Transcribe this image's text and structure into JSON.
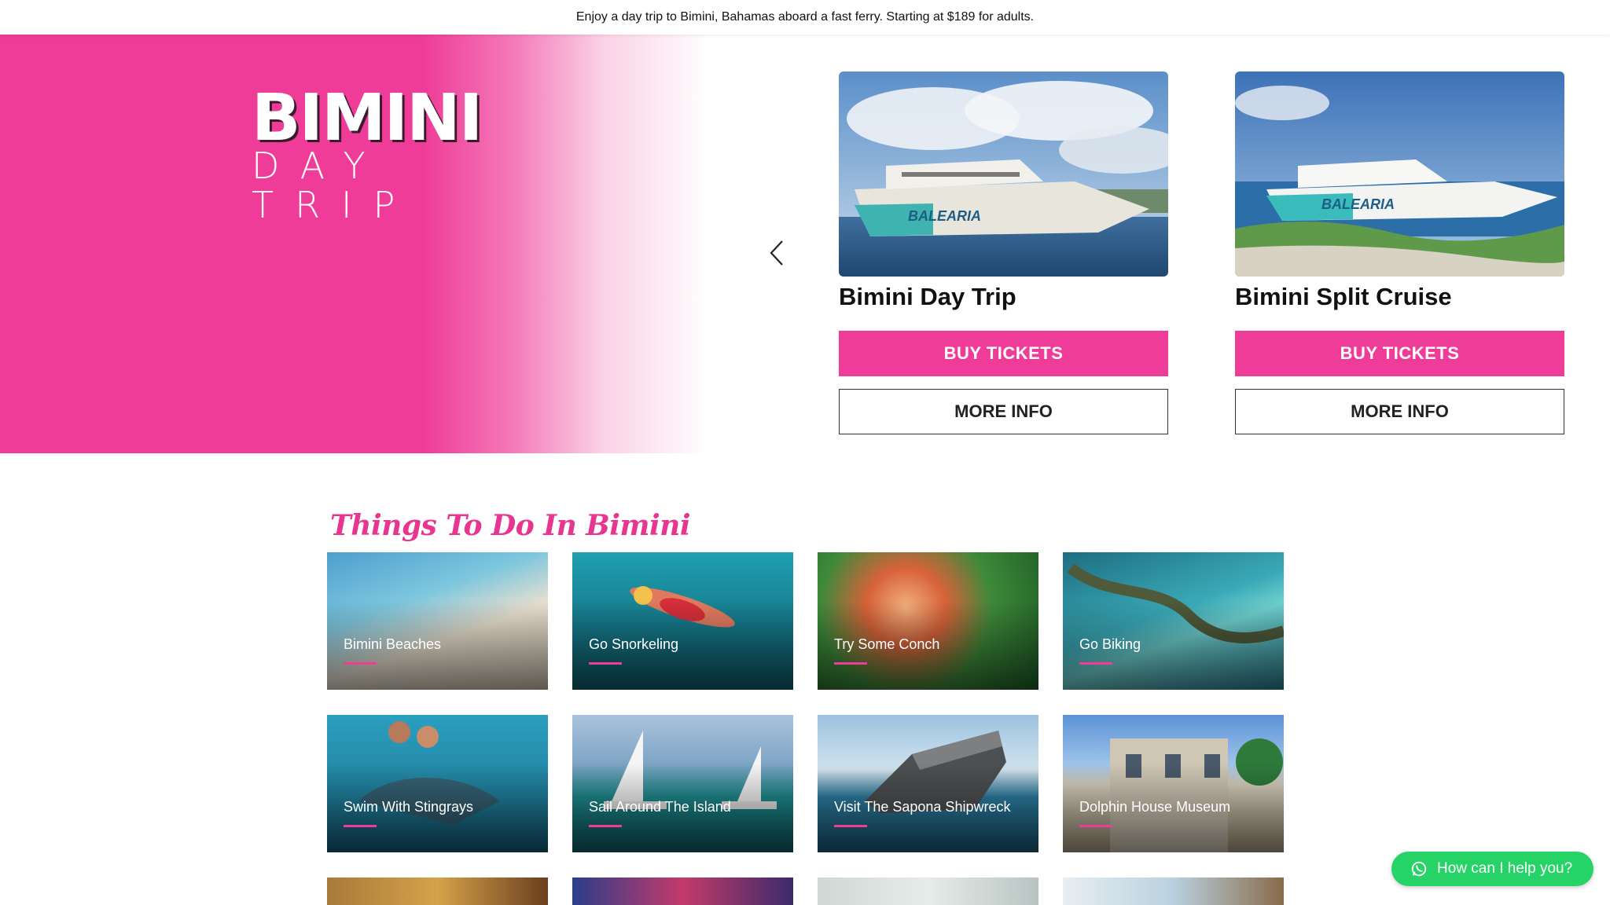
{
  "announcement": "Enjoy a day trip to Bimini, Bahamas aboard a fast ferry. Starting at $189 for adults.",
  "logo": {
    "line1": "BIMINI",
    "line2": "DAY TRIP"
  },
  "colors": {
    "brand_pink": "#ee3c98",
    "whatsapp_green": "#25d366"
  },
  "cards": [
    {
      "title": "Bimini Day Trip",
      "buy_label": "BUY TICKETS",
      "info_label": "MORE INFO"
    },
    {
      "title": "Bimini Split Cruise",
      "buy_label": "BUY TICKETS",
      "info_label": "MORE INFO"
    }
  ],
  "section": {
    "title": "Things To Do In Bimini"
  },
  "tiles": [
    {
      "label": "Bimini Beaches"
    },
    {
      "label": "Go Snorkeling"
    },
    {
      "label": "Try Some Conch"
    },
    {
      "label": "Go Biking"
    },
    {
      "label": "Swim With Stingrays"
    },
    {
      "label": "Sail Around The Island"
    },
    {
      "label": "Visit The Sapona Shipwreck"
    },
    {
      "label": "Dolphin House Museum"
    }
  ],
  "chat": {
    "label": "How can I help you?"
  },
  "icons": {
    "prev": "chevron-left-icon",
    "chat": "whatsapp-icon"
  }
}
